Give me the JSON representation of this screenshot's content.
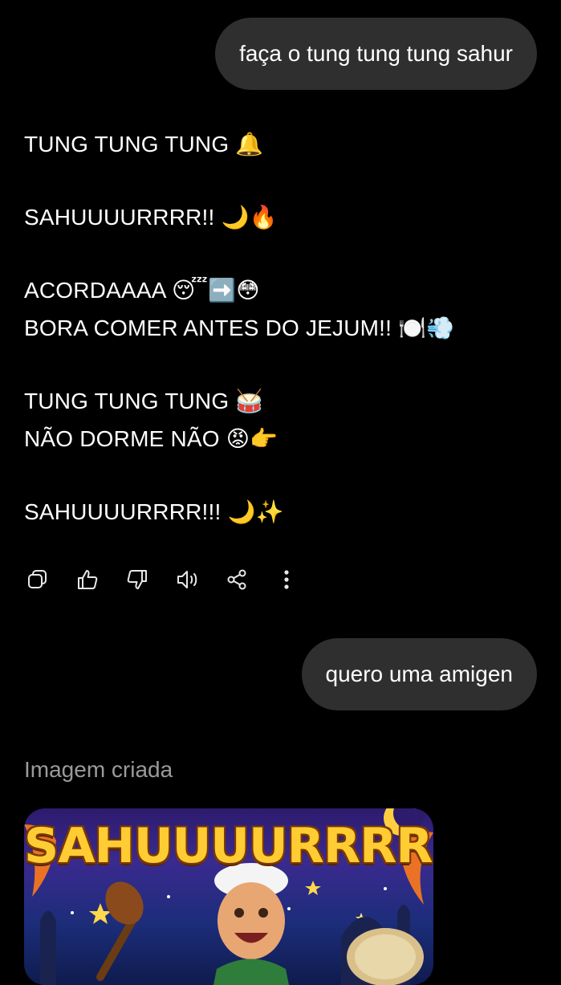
{
  "messages": {
    "user_1": "faça o tung tung tung sahur",
    "assistant_lines": [
      "TUNG TUNG TUNG 🔔",
      "",
      "SAHUUUURRRR!! 🌙🔥",
      "",
      "ACORDAAAA 😴➡️😳",
      "BORA COMER ANTES DO JEJUM!! 🍽️💨",
      "",
      "TUNG TUNG TUNG 🥁",
      "NÃO DORME NÃO 😡👉",
      "",
      "SAHUUUURRRR!!! 🌙✨"
    ],
    "user_2": "quero uma amigen",
    "image_caption": "Imagem criada",
    "image_title": "SAHUUUURRRR!!"
  },
  "actions": [
    {
      "icon": "copy-icon"
    },
    {
      "icon": "thumbs-up-icon"
    },
    {
      "icon": "thumbs-down-icon"
    },
    {
      "icon": "speaker-icon"
    },
    {
      "icon": "share-icon"
    },
    {
      "icon": "more-vertical-icon"
    }
  ],
  "colors": {
    "background": "#000000",
    "user_bubble": "#2f2f2f",
    "text": "#ffffff",
    "caption": "#9a9a9a",
    "image_title": "#ffcc33"
  }
}
